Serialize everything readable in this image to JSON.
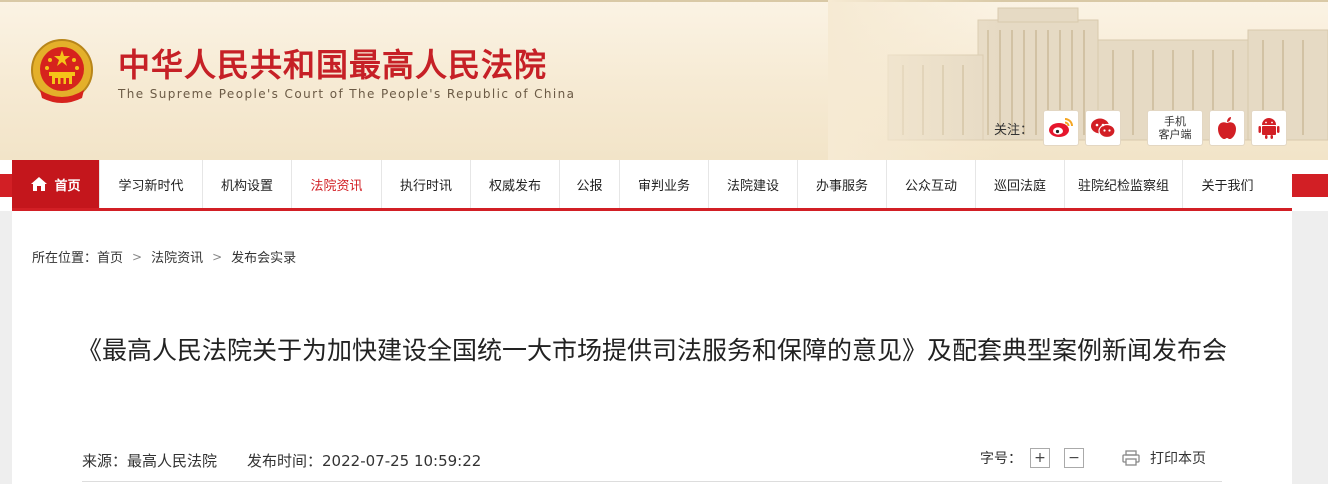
{
  "header": {
    "title": "中华人民共和国最高人民法院",
    "subtitle": "The Supreme People's Court of The People's Republic of China",
    "follow_label": "关注：",
    "follow_icons": [
      "weibo-icon",
      "wechat-icon"
    ],
    "mobile_client": {
      "line1": "手机",
      "line2": "客户端"
    },
    "platform_icons": [
      "apple-icon",
      "android-icon"
    ]
  },
  "nav": {
    "items": [
      {
        "label": "首页",
        "type": "home"
      },
      {
        "label": "学习新时代"
      },
      {
        "label": "机构设置"
      },
      {
        "label": "法院资讯",
        "active": true
      },
      {
        "label": "执行时讯"
      },
      {
        "label": "权威发布"
      },
      {
        "label": "公报"
      },
      {
        "label": "审判业务"
      },
      {
        "label": "法院建设"
      },
      {
        "label": "办事服务"
      },
      {
        "label": "公众互动"
      },
      {
        "label": "巡回法庭"
      },
      {
        "label": "驻院纪检监察组"
      },
      {
        "label": "关于我们"
      }
    ]
  },
  "breadcrumb": {
    "prefix": "所在位置：",
    "items": [
      "首页",
      "法院资讯",
      "发布会实录"
    ]
  },
  "article": {
    "title": "《最高人民法院关于为加快建设全国统一大市场提供司法服务和保障的意见》及配套典型案例新闻发布会",
    "source": "来源：最高人民法院",
    "publish_time": "发布时间：2022-07-25 10:59:22",
    "font_size_label": "字号：",
    "increase": "+",
    "decrease": "−",
    "print_label": "打印本页"
  },
  "colors": {
    "brand_red": "#d21f25",
    "home_red": "#c4161c",
    "header_bg": "#f6ead3"
  }
}
